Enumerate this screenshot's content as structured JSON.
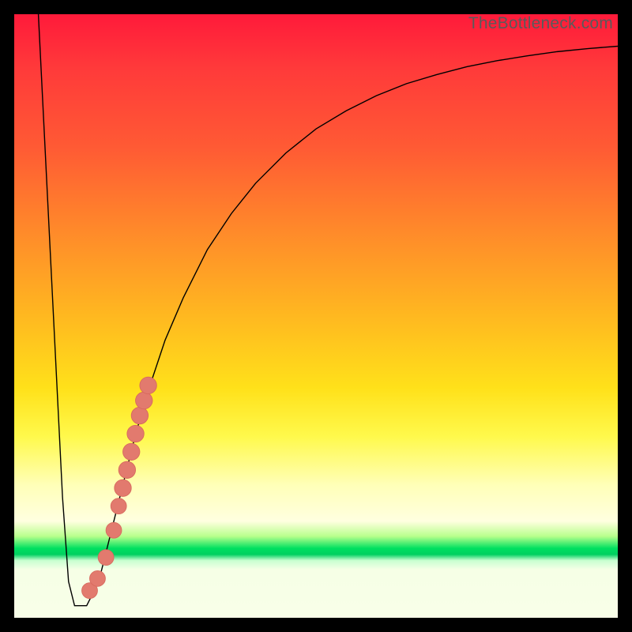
{
  "watermark": "TheBottleneck.com",
  "colors": {
    "curve_stroke": "#000000",
    "marker_fill": "#e27a6e",
    "marker_stroke": "#d86a5e"
  },
  "chart_data": {
    "type": "line",
    "title": "",
    "xlabel": "",
    "ylabel": "",
    "xlim": [
      0,
      100
    ],
    "ylim": [
      0,
      100
    ],
    "series": [
      {
        "name": "bottleneck-curve",
        "x": [
          4,
          5,
          6,
          7,
          8,
          9,
          10,
          11,
          12,
          14,
          16,
          18,
          20,
          22,
          25,
          28,
          32,
          36,
          40,
          45,
          50,
          55,
          60,
          65,
          70,
          75,
          80,
          85,
          90,
          95,
          100
        ],
        "values": [
          100,
          80,
          60,
          40,
          20,
          6,
          2,
          2,
          2,
          6,
          14,
          22,
          30,
          37,
          46,
          53,
          61,
          67,
          72,
          77,
          81,
          84,
          86.5,
          88.5,
          90,
          91.3,
          92.3,
          93.1,
          93.8,
          94.3,
          94.7
        ]
      }
    ],
    "markers": [
      {
        "x": 12.5,
        "y": 4.5,
        "r": 1.3
      },
      {
        "x": 13.8,
        "y": 6.5,
        "r": 1.3
      },
      {
        "x": 15.2,
        "y": 10.0,
        "r": 1.3
      },
      {
        "x": 16.5,
        "y": 14.5,
        "r": 1.3
      },
      {
        "x": 17.3,
        "y": 18.5,
        "r": 1.3
      },
      {
        "x": 18.0,
        "y": 21.5,
        "r": 1.4
      },
      {
        "x": 18.7,
        "y": 24.5,
        "r": 1.4
      },
      {
        "x": 19.4,
        "y": 27.5,
        "r": 1.4
      },
      {
        "x": 20.1,
        "y": 30.5,
        "r": 1.4
      },
      {
        "x": 20.8,
        "y": 33.5,
        "r": 1.4
      },
      {
        "x": 21.5,
        "y": 36.0,
        "r": 1.4
      },
      {
        "x": 22.2,
        "y": 38.5,
        "r": 1.4
      }
    ]
  }
}
